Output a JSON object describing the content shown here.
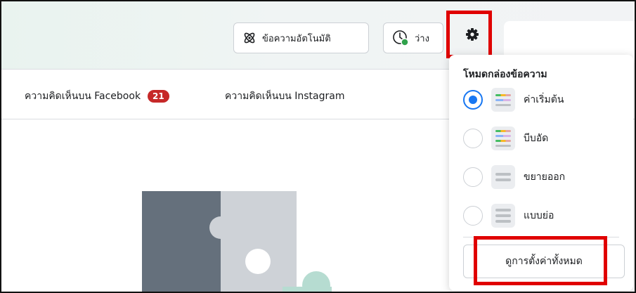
{
  "header": {
    "auto_reply_label": "ข้อความอัตโนมัติ",
    "away_label": "ว่าง",
    "status_color": "#31a24c"
  },
  "tabs": [
    {
      "label": "ความคิดเห็นบน Facebook",
      "badge": "21"
    },
    {
      "label": "ความคิดเห็นบน Instagram"
    }
  ],
  "menu": {
    "title": "โหมดกล่องข้อความ",
    "options": [
      {
        "label": "ค่าเริ่มต้น",
        "selected": true
      },
      {
        "label": "บีบอัด",
        "selected": false
      },
      {
        "label": "ขยายออก",
        "selected": false
      },
      {
        "label": "แบบย่อ",
        "selected": false
      }
    ],
    "view_all_label": "ดูการตั้งค่าทั้งหมด"
  },
  "colors": {
    "highlight": "#e00000",
    "accent": "#1877f2",
    "badge": "#c62828"
  }
}
